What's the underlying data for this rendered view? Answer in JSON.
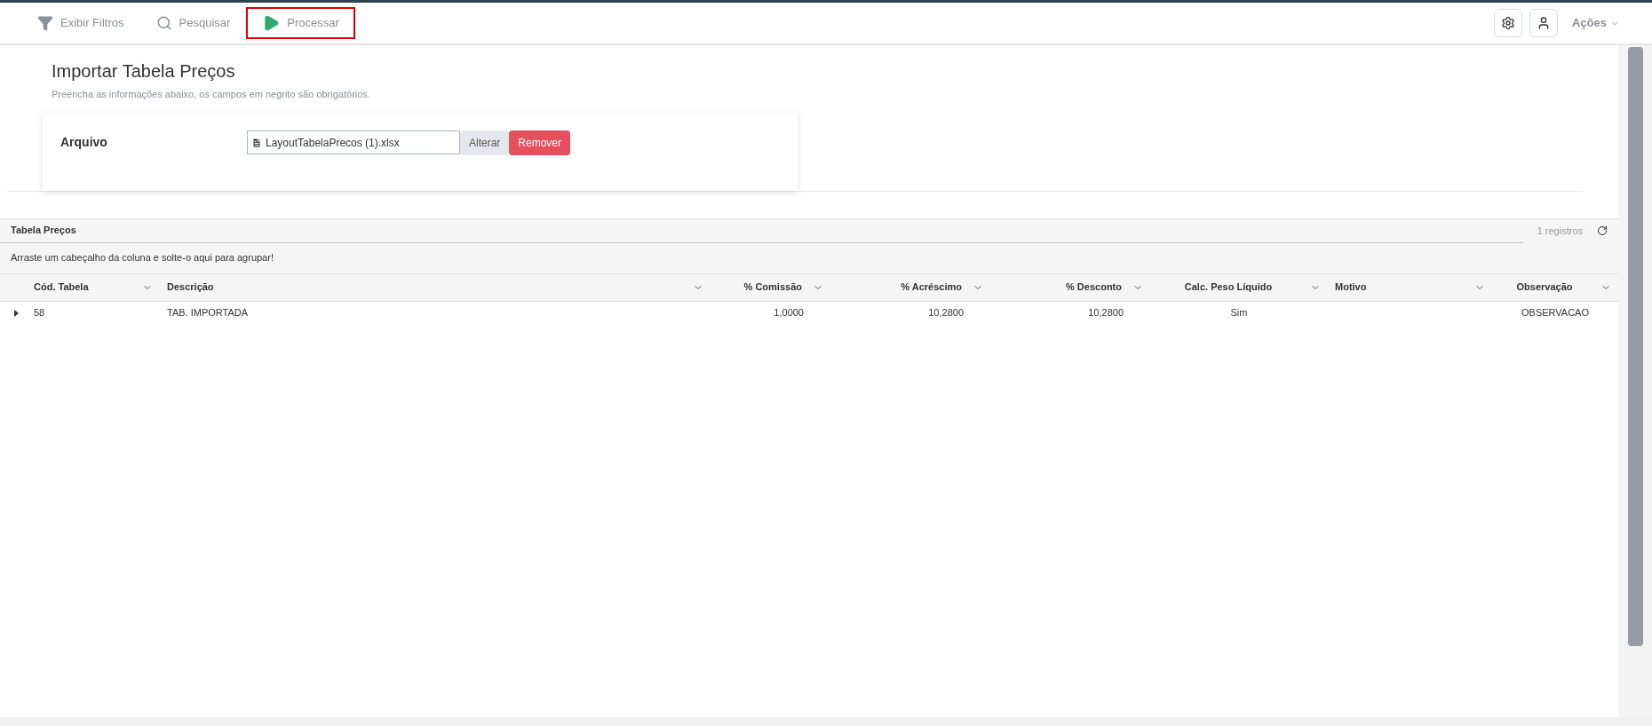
{
  "toolbar": {
    "buttons": [
      {
        "label": "Exibir Filtros",
        "kind": "filter",
        "highlighted": false
      },
      {
        "label": "Pesquisar",
        "kind": "search",
        "highlighted": false
      },
      {
        "label": "Processar",
        "kind": "play",
        "highlighted": true
      }
    ],
    "actions_menu": "Ações"
  },
  "form": {
    "title": "Importar Tabela Preços",
    "subtitle": "Preencha as informações abaixo, os campos em negrito são obrigatórios.",
    "fields": [
      {
        "label": "Arquivo",
        "value": "LayoutTabelaPrecos (1).xlsx",
        "buttons": [
          {
            "label": "Alterar",
            "kind": "secondary"
          },
          {
            "label": "Remover",
            "kind": "danger"
          }
        ]
      }
    ]
  },
  "grid": {
    "title": "Tabela Preços",
    "count": "1 registros",
    "group_hint": "Arraste um cabeçalho da coluna e solte-o aqui para agrupar!",
    "columns": [
      {
        "label": "Cód. Tabela"
      },
      {
        "label": "Descrição"
      },
      {
        "label": "% Comissão"
      },
      {
        "label": "% Acréscimo"
      },
      {
        "label": "% Desconto"
      },
      {
        "label": "Calc. Peso Líquido"
      },
      {
        "label": "Motivo"
      },
      {
        "label": "Observação"
      }
    ],
    "rows": [
      {
        "cells": [
          "58",
          "TAB. IMPORTADA",
          "1,0000",
          "10,2800",
          "10,2800",
          "Sim",
          "",
          "OBSERVACAO"
        ]
      }
    ]
  }
}
